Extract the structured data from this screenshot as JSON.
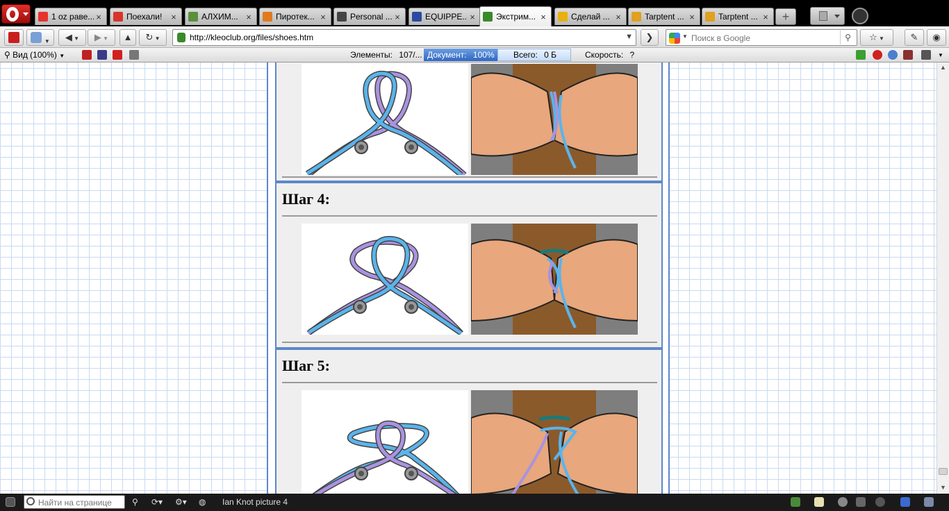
{
  "tabs": [
    {
      "label": "1 oz раве...",
      "color": "#e8322c",
      "active": false
    },
    {
      "label": "Поехали!",
      "color": "#d8342c",
      "active": false
    },
    {
      "label": "АЛХИМ...",
      "color": "#5b8f3c",
      "active": false
    },
    {
      "label": "Пиротек...",
      "color": "#e07a1e",
      "active": false
    },
    {
      "label": "Personal ...",
      "color": "#444444",
      "active": false
    },
    {
      "label": "EQUIPPE...",
      "color": "#2a4aa0",
      "active": false
    },
    {
      "label": "Экстрим...",
      "color": "#3a8a2a",
      "active": true
    },
    {
      "label": "Сделай ...",
      "color": "#e8b010",
      "active": false
    },
    {
      "label": "Tarptent ...",
      "color": "#e0a020",
      "active": false
    },
    {
      "label": "Tarptent ...",
      "color": "#e0a020",
      "active": false
    }
  ],
  "nav": {
    "url": "http://kleoclub.org/files/shoes.htm",
    "search_placeholder": "Поиск в Google"
  },
  "status": {
    "zoom": "Вид (100%)",
    "elements_label": "Элементы:",
    "elements_value": "107/...",
    "document_label": "Документ:",
    "document_value": "100%",
    "total_label": "Всего:",
    "total_value": "0 Б",
    "speed_label": "Скорость:",
    "speed_value": "?"
  },
  "content": {
    "steps": [
      {
        "title": ""
      },
      {
        "title": "Шаг 4:"
      },
      {
        "title": "Шаг 5:"
      }
    ]
  },
  "bottom": {
    "find_placeholder": "Найти на странице",
    "status_text": "Ian Knot picture 4"
  }
}
